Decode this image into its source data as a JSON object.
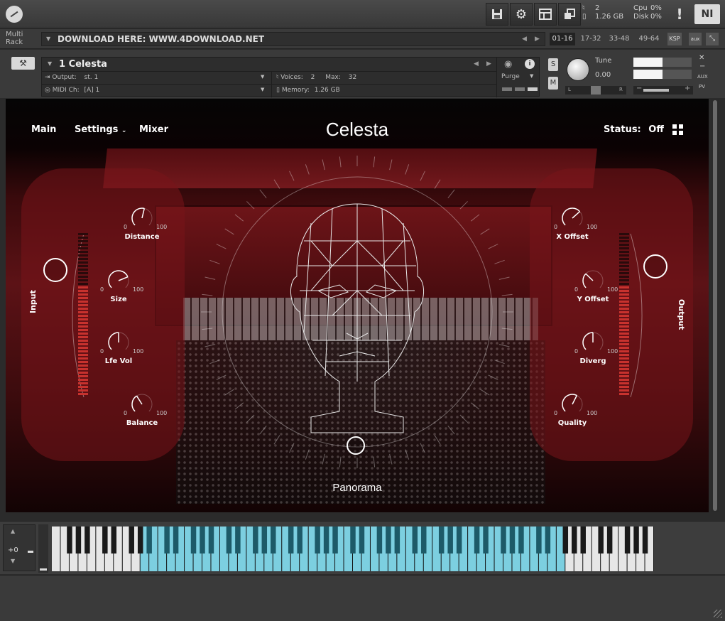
{
  "topbar": {
    "buttons": [
      {
        "name": "save",
        "icon": "floppy-disk-icon"
      },
      {
        "name": "options",
        "icon": "gear-icon"
      },
      {
        "name": "view",
        "icon": "layout-icon"
      },
      {
        "name": "minimize-view",
        "icon": "restore-window-icon"
      }
    ],
    "stats": {
      "voices": "2",
      "memory": "1.26 GB",
      "cpu_label": "Cpu",
      "cpu_value": "0%",
      "disk_label": "Disk",
      "disk_value": "0%"
    },
    "alert": "!",
    "ni_logo": "NI"
  },
  "rack": {
    "label_line1": "Multi",
    "label_line2": "Rack",
    "name": "DOWNLOAD HERE: WWW.4DOWNLOAD.NET",
    "tabs": [
      "01-16",
      "17-32",
      "33-48",
      "49-64",
      "KSP",
      "aux"
    ],
    "active_tab": "01-16"
  },
  "instrument": {
    "name": "1 Celesta",
    "output_label": "Output:",
    "output_value": "st. 1",
    "midi_label": "MIDI Ch:",
    "midi_value": "[A]  1",
    "voices_label": "Voices:",
    "voices_value": "2",
    "max_label": "Max:",
    "max_value": "32",
    "memory_label": "Memory:",
    "memory_value": "1.26 GB",
    "purge_label": "Purge",
    "solo": "S",
    "mute": "M",
    "tune_label": "Tune",
    "tune_value": "0.00",
    "pan_left": "L",
    "pan_right": "R",
    "aux_label": "AUX",
    "pv_label": "PV",
    "meter_levels": [
      0.5,
      0.5
    ],
    "volume_level": 0.62
  },
  "panel": {
    "nav": {
      "main": "Main",
      "settings": "Settings",
      "mixer": "Mixer"
    },
    "title": "Celesta",
    "status_label": "Status:",
    "status_value": "Off",
    "input_label": "Input",
    "output_label": "Output",
    "panorama_label": "Panorama",
    "knobs_left": [
      {
        "label": "Distance",
        "min": "0",
        "max": "100",
        "value": 0.55
      },
      {
        "label": "Size",
        "min": "0",
        "max": "100",
        "value": 0.75
      },
      {
        "label": "Lfe Vol",
        "min": "0",
        "max": "100",
        "value": 0.5
      },
      {
        "label": "Balance",
        "min": "0",
        "max": "100",
        "value": 0.38
      }
    ],
    "knobs_right": [
      {
        "label": "X Offset",
        "min": "0",
        "max": "100",
        "value": 0.68
      },
      {
        "label": "Y Offset",
        "min": "0",
        "max": "100",
        "value": 0.33
      },
      {
        "label": "Diverg",
        "min": "0",
        "max": "100",
        "value": 0.5
      },
      {
        "label": "Quality",
        "min": "0",
        "max": "100",
        "value": 0.6
      }
    ],
    "accent": "#c8322e"
  },
  "keyboard": {
    "octave": "+0",
    "highlight_color": "#7ccfe0"
  }
}
